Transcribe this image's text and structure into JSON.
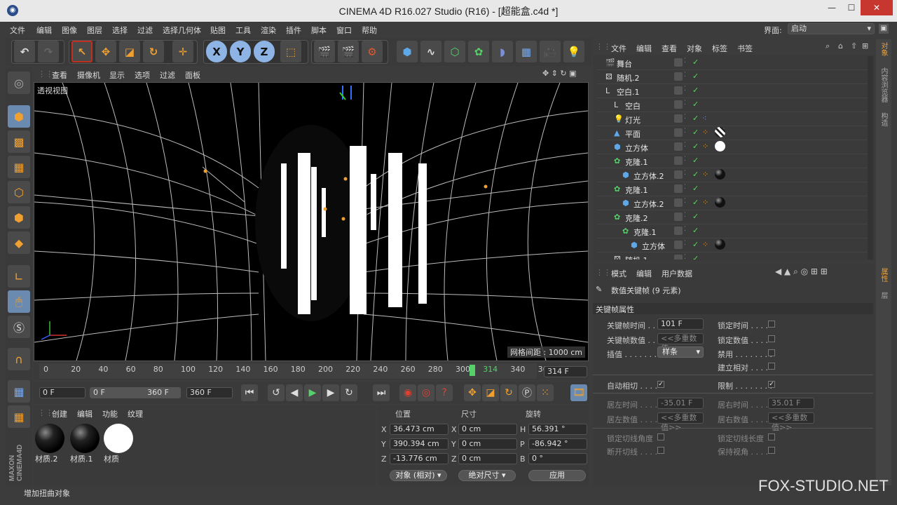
{
  "window": {
    "title": "CINEMA 4D R16.027 Studio (R16) - [超能盒.c4d *]",
    "controls": [
      "—",
      "☐",
      "✕"
    ]
  },
  "menu": [
    "文件",
    "编辑",
    "图像",
    "图层",
    "选择",
    "过滤",
    "选择几何体",
    "贴图",
    "工具",
    "渲染",
    "插件",
    "脚本",
    "窗口",
    "帮助"
  ],
  "layout_label": "界面:",
  "layout_value": "启动",
  "viewport": {
    "menu": [
      "查看",
      "摄像机",
      "显示",
      "选项",
      "过滤",
      "面板"
    ],
    "view_name": "透视视图",
    "grid_info": "网格间距 : 1000 cm"
  },
  "timeline": {
    "ticks": [
      "0",
      "20",
      "40",
      "60",
      "80",
      "100",
      "120",
      "140",
      "160",
      "180",
      "200",
      "220",
      "240",
      "260",
      "280",
      "300",
      "314",
      "340",
      "360"
    ],
    "current": "314",
    "frame_field": "314 F"
  },
  "playback": {
    "start": "0 F",
    "range_start": "0 F",
    "range_end": "360 F",
    "end": "360 F"
  },
  "materials": {
    "menu": [
      "创建",
      "编辑",
      "功能",
      "纹理"
    ],
    "items": [
      {
        "name": "材质.2",
        "color": "#111111"
      },
      {
        "name": "材质.1",
        "color": "#111111"
      },
      {
        "name": "材质",
        "color": "#ffffff"
      }
    ]
  },
  "coords": {
    "headers": [
      "位置",
      "尺寸",
      "旋转"
    ],
    "rows": [
      {
        "axis": "X",
        "pos": "36.473 cm",
        "size_axis": "X",
        "size": "0 cm",
        "rot_axis": "H",
        "rot": "56.391 °"
      },
      {
        "axis": "Y",
        "pos": "390.394 cm",
        "size_axis": "Y",
        "size": "0 cm",
        "rot_axis": "P",
        "rot": "-86.942 °"
      },
      {
        "axis": "Z",
        "pos": "-13.776 cm",
        "size_axis": "Z",
        "size": "0 cm",
        "rot_axis": "B",
        "rot": "0 °"
      }
    ],
    "mode": "对象 (相对)",
    "size_mode": "绝对尺寸",
    "apply": "应用"
  },
  "objects": {
    "menu": [
      "文件",
      "编辑",
      "查看",
      "对象",
      "标签",
      "书签"
    ],
    "items": [
      {
        "name": "舞台",
        "indent": 0
      },
      {
        "name": "随机.2",
        "indent": 0
      },
      {
        "name": "空白.1",
        "indent": 0
      },
      {
        "name": "空白",
        "indent": 1
      },
      {
        "name": "灯光",
        "indent": 1
      },
      {
        "name": "平面",
        "indent": 1
      },
      {
        "name": "立方体",
        "indent": 1
      },
      {
        "name": "克隆.1",
        "indent": 1
      },
      {
        "name": "立方体.2",
        "indent": 2
      },
      {
        "name": "克隆.1",
        "indent": 1
      },
      {
        "name": "立方体.2",
        "indent": 2
      },
      {
        "name": "克隆.2",
        "indent": 1
      },
      {
        "name": "克隆.1",
        "indent": 2
      },
      {
        "name": "立方体",
        "indent": 3
      },
      {
        "name": "随机.1",
        "indent": 1
      }
    ]
  },
  "attributes": {
    "menu": [
      "模式",
      "编辑",
      "用户数据"
    ],
    "title": "数值关键帧 (9 元素)",
    "section": "关键帧属性",
    "fields": {
      "key_time_label": "关键帧时间 . .",
      "key_time": "101 F",
      "key_value_label": "关键帧数值 . .",
      "key_value": "<<多重数值>>",
      "interp_label": "插值 . . . . . . . . . .",
      "interp": "样条",
      "lock_time": "锁定时间 . . . .",
      "lock_value": "锁定数值 . . . .",
      "mute": "禁用 . . . . . . . .",
      "relative": "建立相对 . . . .",
      "auto_tangent": "自动相切 . . . .",
      "clamp": "限制 . . . . . . . .",
      "left_time_label": "居左时间 . . . .",
      "left_time": "-35.01 F",
      "right_time_label": "居右时间 . . . .",
      "right_time": "35.01 F",
      "left_value_label": "居左数值 . . . .",
      "left_value": "<<多重数值>>",
      "right_value_label": "居右数值 . . . .",
      "right_value": "<<多重数值>>",
      "lock_angle": "锁定切线角度",
      "lock_len": "锁定切线长度",
      "break": "断开切线 . . . .",
      "keep": "保持视角 . . . ."
    }
  },
  "right_tabs": [
    "对象",
    "内容浏览器",
    "构造",
    "属性",
    "层"
  ],
  "status": "增加扭曲对象",
  "watermark": "FOX-STUDIO.NET",
  "logo": "MAXON CINEMA4D"
}
